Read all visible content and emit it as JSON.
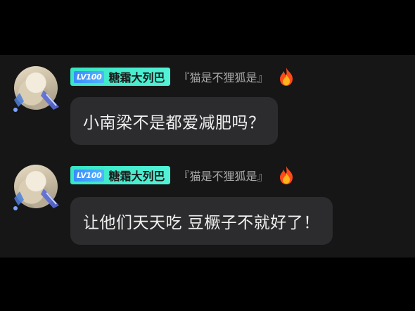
{
  "messages": [
    {
      "level": "LV100",
      "username": "糖霜大列巴",
      "tag": "『猫是不狸狐是』",
      "text": "小南梁不是都爱减肥吗？"
    },
    {
      "level": "LV100",
      "username": "糖霜大列巴",
      "tag": "『猫是不狸狐是』",
      "text": "让他们天天吃 豆橛子不就好了！"
    }
  ],
  "colors": {
    "background": "#000000",
    "panel": "#161616",
    "bubble": "#2c2c2e",
    "name_badge": "#36e6c4",
    "level_badge": "#3a8cff"
  },
  "icons": {
    "fire": "fire-icon",
    "avatar_frame": "avatar-frame-icon"
  }
}
